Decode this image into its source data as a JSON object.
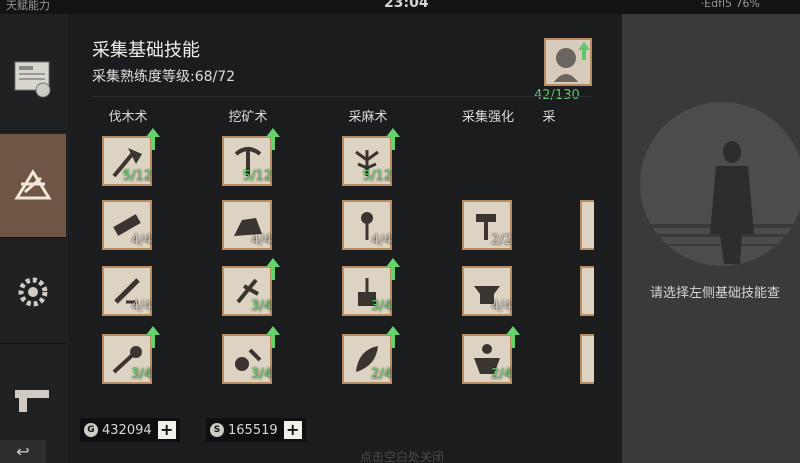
{
  "topbar": {
    "left": "天赋能力",
    "time": "23:04",
    "right": "·Edfl5 76%"
  },
  "panel": {
    "title": "采集基础技能",
    "subtitle": "采集熟练度等级:68/72",
    "points": "42/130"
  },
  "columns": [
    "伐木术",
    "挖矿术",
    "采麻术",
    "采集强化",
    "采"
  ],
  "skills": [
    {
      "col": 0,
      "row": 0,
      "level": "5/12",
      "upgrade": true,
      "icon": "axe-icon"
    },
    {
      "col": 0,
      "row": 1,
      "level": "4/4",
      "upgrade": false,
      "icon": "log-icon"
    },
    {
      "col": 0,
      "row": 2,
      "level": "4/4",
      "upgrade": false,
      "icon": "saw-icon"
    },
    {
      "col": 0,
      "row": 3,
      "level": "3/4",
      "upgrade": true,
      "icon": "chop-icon"
    },
    {
      "col": 1,
      "row": 0,
      "level": "5/12",
      "upgrade": true,
      "icon": "pickaxe-icon"
    },
    {
      "col": 1,
      "row": 1,
      "level": "4/4",
      "upgrade": false,
      "icon": "rock-icon"
    },
    {
      "col": 1,
      "row": 2,
      "level": "3/4",
      "upgrade": true,
      "icon": "drill-icon"
    },
    {
      "col": 1,
      "row": 3,
      "level": "3/4",
      "upgrade": true,
      "icon": "ore-icon"
    },
    {
      "col": 2,
      "row": 0,
      "level": "5/12",
      "upgrade": true,
      "icon": "hemp-icon"
    },
    {
      "col": 2,
      "row": 1,
      "level": "4/4",
      "upgrade": false,
      "icon": "flower-icon"
    },
    {
      "col": 2,
      "row": 2,
      "level": "3/4",
      "upgrade": true,
      "icon": "hand-plant-icon"
    },
    {
      "col": 2,
      "row": 3,
      "level": "2/4",
      "upgrade": true,
      "icon": "leaf-icon"
    },
    {
      "col": 3,
      "row": 1,
      "level": "2/2",
      "upgrade": false,
      "icon": "hammer-icon"
    },
    {
      "col": 3,
      "row": 2,
      "level": "4/4",
      "upgrade": false,
      "icon": "anvil-icon"
    },
    {
      "col": 3,
      "row": 3,
      "level": "2/4",
      "upgrade": true,
      "icon": "strength-icon"
    }
  ],
  "currency": [
    {
      "symbol": "G",
      "amount": "432094"
    },
    {
      "symbol": "S",
      "amount": "165519"
    }
  ],
  "right": {
    "hint": "请选择左侧基础技能查"
  },
  "bottom_hint": "点击空白处关闭",
  "colors": {
    "green": "#64d36b",
    "active_tab": "#6e5544",
    "tile_border": "#b98c62"
  }
}
